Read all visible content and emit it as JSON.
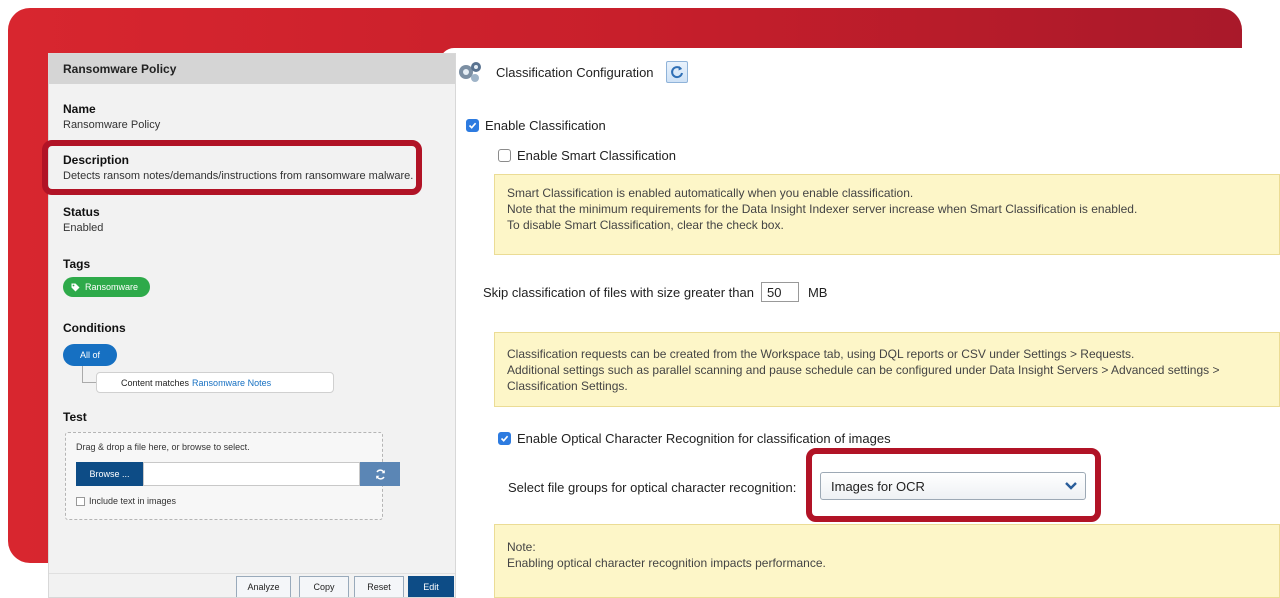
{
  "left_panel": {
    "header_title": "Ransomware Policy",
    "name_label": "Name",
    "name_value": "Ransomware Policy",
    "description_label": "Description",
    "description_value": "Detects ransom notes/demands/instructions from ransomware malware.",
    "status_label": "Status",
    "status_value": "Enabled",
    "tags_label": "Tags",
    "tag": "Ransomware",
    "conditions_label": "Conditions",
    "all_of": "All of",
    "condition_prefix": "Content matches",
    "condition_link": "Ransomware Notes",
    "test_label": "Test",
    "drop_hint": "Drag & drop a file here, or browse to select.",
    "browse_label": "Browse ...",
    "include_text_label": "Include text in images",
    "buttons": {
      "analyze": "Analyze",
      "copy": "Copy",
      "reset": "Reset",
      "edit": "Edit"
    }
  },
  "right_panel": {
    "title": "Classification Configuration",
    "enable_classification": {
      "label": "Enable Classification",
      "checked": true
    },
    "enable_smart": {
      "label": "Enable Smart Classification",
      "checked": false
    },
    "smart_note": {
      "line1": "Smart Classification is enabled automatically when you enable classification.",
      "line2": "Note that the minimum requirements for the Data Insight Indexer server increase when Smart Classification is enabled.",
      "line3": "To disable Smart Classification, clear the check box."
    },
    "skip": {
      "label": "Skip classification of files with size greater than",
      "value": "50",
      "unit": "MB"
    },
    "requests_note": {
      "line1": "Classification requests can be created from the Workspace tab, using DQL reports or CSV under Settings > Requests.",
      "line2": "Additional settings such as parallel scanning and pause schedule can be configured under Data Insight Servers > Advanced settings >",
      "line3": "Classification Settings."
    },
    "enable_ocr": {
      "label": "Enable Optical Character Recognition for classification of images",
      "checked": true
    },
    "ocr_select": {
      "label": "Select file groups for optical character recognition:",
      "value": "Images for OCR"
    },
    "perf_note": {
      "line1": "Note:",
      "line2": "Enabling optical character recognition impacts performance."
    }
  },
  "colors": {
    "brand_red": "#c81f2b",
    "highlight": "#b11326",
    "primary_blue": "#0d4c86",
    "tag_green": "#2eaa4a",
    "note_yellow": "#fdf6c8"
  }
}
